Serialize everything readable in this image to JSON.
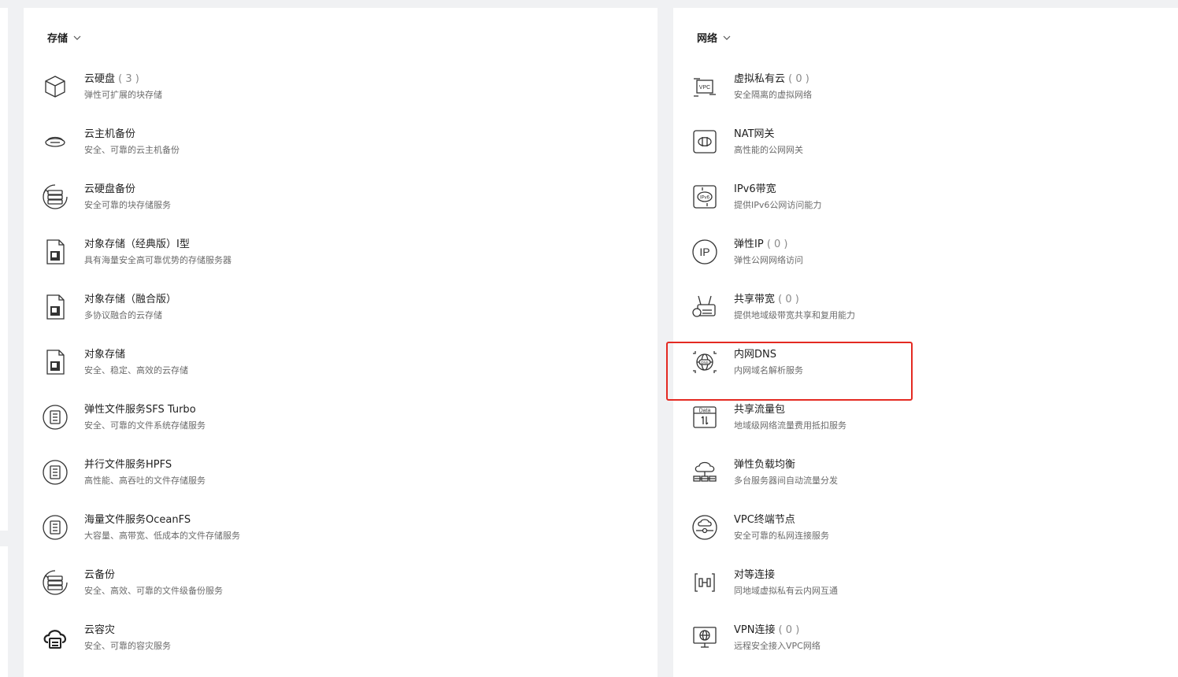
{
  "storage": {
    "header": "存储",
    "items": [
      {
        "title": "云硬盘",
        "count": " ( 3 )",
        "desc": "弹性可扩展的块存储",
        "icon": "cube-icon"
      },
      {
        "title": "云主机备份",
        "count": "",
        "desc": "安全、可靠的云主机备份",
        "icon": "disk-backup-icon"
      },
      {
        "title": "云硬盘备份",
        "count": "",
        "desc": "安全可靠的块存储服务",
        "icon": "server-backup-icon"
      },
      {
        "title": "对象存储（经典版）Ⅰ型",
        "count": "",
        "desc": "具有海量安全高可靠优势的存储服务器",
        "icon": "object-storage-icon"
      },
      {
        "title": "对象存储（融合版）",
        "count": "",
        "desc": "多协议融合的云存储",
        "icon": "object-storage-icon"
      },
      {
        "title": "对象存储",
        "count": "",
        "desc": "安全、稳定、高效的云存储",
        "icon": "object-storage-icon"
      },
      {
        "title": "弹性文件服务SFS Turbo",
        "count": "",
        "desc": "安全、可靠的文件系统存储服务",
        "icon": "file-service-icon"
      },
      {
        "title": "并行文件服务HPFS",
        "count": "",
        "desc": "高性能、高吞吐的文件存储服务",
        "icon": "file-service-icon"
      },
      {
        "title": "海量文件服务OceanFS",
        "count": "",
        "desc": "大容量、高带宽、低成本的文件存储服务",
        "icon": "file-service-icon"
      },
      {
        "title": "云备份",
        "count": "",
        "desc": "安全、高效、可靠的文件级备份服务",
        "icon": "server-backup-icon"
      },
      {
        "title": "云容灾",
        "count": "",
        "desc": "安全、可靠的容灾服务",
        "icon": "cloud-disaster-recovery-icon"
      }
    ]
  },
  "network": {
    "header": "网络",
    "items": [
      {
        "title": "虚拟私有云",
        "count": " ( 0 )",
        "desc": "安全隔离的虚拟网络",
        "icon": "vpc-icon"
      },
      {
        "title": "NAT网关",
        "count": "",
        "desc": "高性能的公网网关",
        "icon": "nat-gateway-icon"
      },
      {
        "title": "IPv6带宽",
        "count": "",
        "desc": "提供IPv6公网访问能力",
        "icon": "ipv6-icon"
      },
      {
        "title": "弹性IP",
        "count": " ( 0 )",
        "desc": "弹性公网网络访问",
        "icon": "ip-icon"
      },
      {
        "title": "共享带宽",
        "count": " ( 0 )",
        "desc": "提供地域级带宽共享和复用能力",
        "icon": "router-icon"
      },
      {
        "title": "内网DNS",
        "count": "",
        "desc": "内网域名解析服务",
        "icon": "dns-globe-icon"
      },
      {
        "title": "共享流量包",
        "count": "",
        "desc": "地域级网络流量费用抵扣服务",
        "icon": "data-package-icon"
      },
      {
        "title": "弹性负载均衡",
        "count": "",
        "desc": "多台服务器间自动流量分发",
        "icon": "load-balancer-icon"
      },
      {
        "title": "VPC终端节点",
        "count": "",
        "desc": "安全可靠的私网连接服务",
        "icon": "endpoint-icon"
      },
      {
        "title": "对等连接",
        "count": "",
        "desc": "同地域虚拟私有云内网互通",
        "icon": "peering-icon"
      },
      {
        "title": "VPN连接",
        "count": " ( 0 )",
        "desc": "远程安全接入VPC网络",
        "icon": "vpn-monitor-icon"
      }
    ]
  },
  "colors": {
    "highlight": "#e42a22",
    "background": "#f0f1f3",
    "panel": "#ffffff"
  }
}
